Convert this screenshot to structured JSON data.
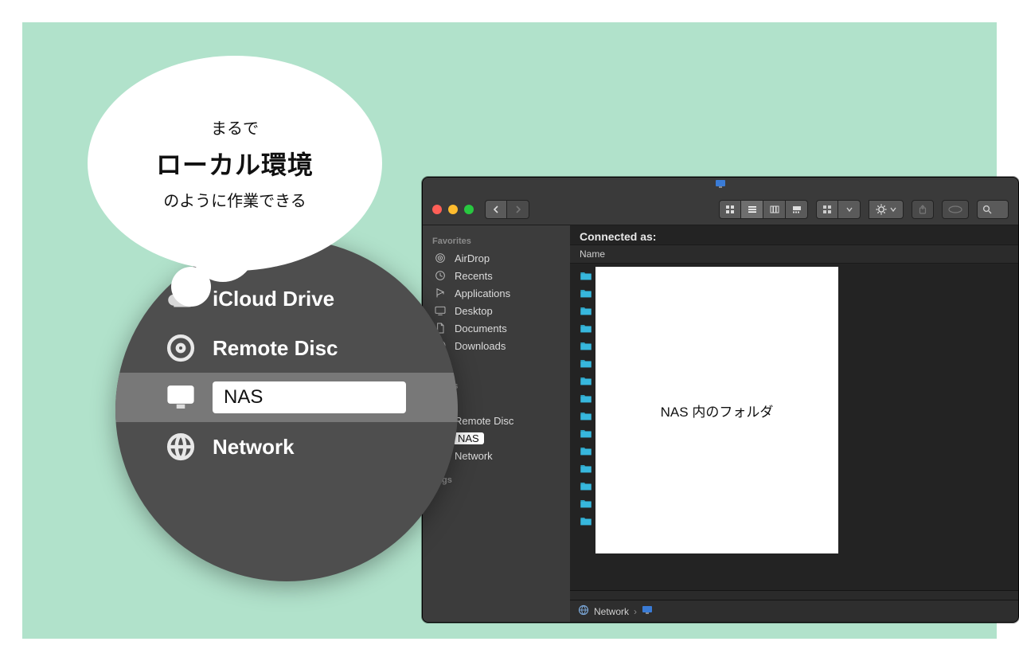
{
  "bubble": {
    "line1": "まるで",
    "line2": "ローカル環境",
    "line3": "のように作業できる"
  },
  "zoom": {
    "items": [
      {
        "icon": "cloud",
        "label": "iCloud Drive"
      },
      {
        "icon": "disc",
        "label": "Remote Disc"
      },
      {
        "icon": "monitor",
        "label": "NAS"
      },
      {
        "icon": "globe",
        "label": "Network"
      }
    ],
    "selected_index": 2,
    "tags_fragment": "gs"
  },
  "finder": {
    "connected_as": "Connected as:",
    "column_header": "Name",
    "sidebar": {
      "favorites_header": "Favorites",
      "locations_header_fragment": "ations",
      "tags_header": "Tags",
      "favorites": [
        {
          "icon": "airdrop",
          "label": "AirDrop"
        },
        {
          "icon": "clock",
          "label": "Recents"
        },
        {
          "icon": "apps",
          "label": "Applications"
        },
        {
          "icon": "desktop",
          "label": "Desktop"
        },
        {
          "icon": "doc",
          "label": "Documents"
        },
        {
          "icon": "download",
          "label": "Downloads"
        },
        {
          "icon": "folder",
          "label": ""
        }
      ],
      "locations": [
        {
          "icon": "drive",
          "label": ""
        },
        {
          "icon": "disc",
          "label": "Remote Disc"
        },
        {
          "icon": "monitor",
          "label": "NAS",
          "selected": true
        },
        {
          "icon": "globe",
          "label": "Network"
        }
      ]
    },
    "folder_row_count": 15,
    "overlay_label": "NAS 内のフォルダ",
    "pathbar": {
      "root": "Network"
    }
  }
}
